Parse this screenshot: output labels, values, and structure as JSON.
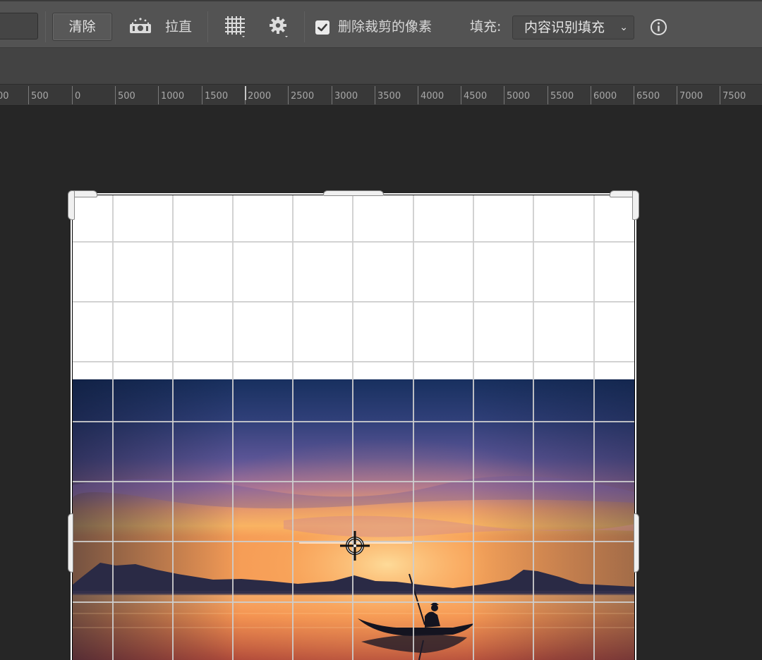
{
  "toolbar": {
    "clear_label": "清除",
    "straighten_label": "拉直",
    "delete_cropped_label": "删除裁剪的像素",
    "delete_cropped_checked": true,
    "fill_label": "填充:",
    "fill_value": "内容识别填充",
    "icons": {
      "straighten": "level-icon",
      "overlay": "grid-overlay-icon",
      "settings": "gear-icon",
      "info": "info-icon",
      "checkbox": "checkbox-checked-icon",
      "dropdown": "chevron-down-icon"
    }
  },
  "ruler": {
    "labels": [
      "00",
      "500",
      "0",
      "500",
      "1000",
      "1500",
      "2000",
      "2500",
      "3000",
      "3500",
      "4000",
      "4500",
      "5000",
      "5500",
      "6000",
      "6500",
      "7000",
      "7500"
    ]
  },
  "colors": {
    "sky_top": "#1c2f60",
    "sky_mid": "#4a4f8e",
    "sunset_glow": "#f0a050",
    "water": "#f08a45"
  }
}
